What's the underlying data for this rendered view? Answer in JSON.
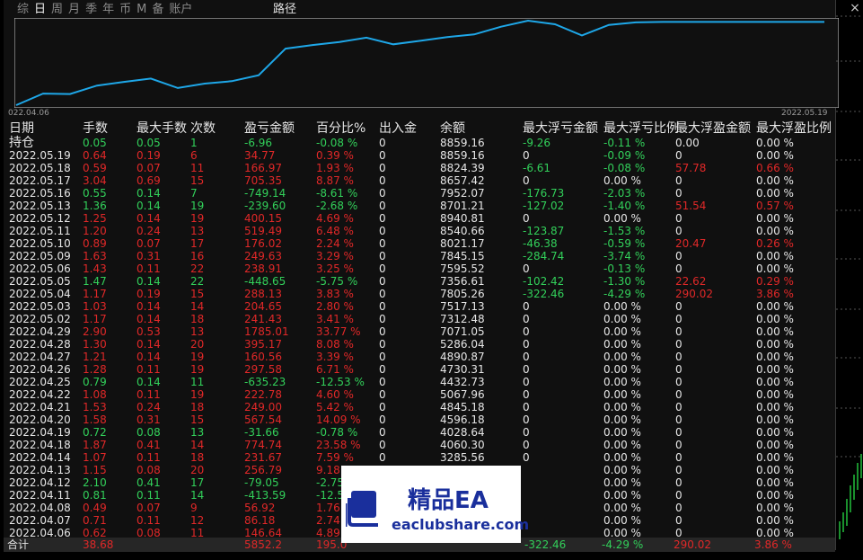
{
  "tabs": [
    "综",
    "日",
    "周",
    "月",
    "季",
    "年",
    "币",
    "M",
    "备",
    "账户"
  ],
  "active_tab": 1,
  "curve_label": "路径",
  "chart": {
    "start_label": "022.04.06",
    "end_label": "2022.05.19",
    "line_color": "#1ea7e8"
  },
  "chart_data": {
    "type": "line",
    "x": [
      "2022.04.06",
      "2022.04.07",
      "2022.04.08",
      "2022.04.11",
      "2022.04.12",
      "2022.04.13",
      "2022.04.14",
      "2022.04.18",
      "2022.04.19",
      "2022.04.20",
      "2022.04.21",
      "2022.04.22",
      "2022.04.25",
      "2022.04.26",
      "2022.04.27",
      "2022.04.28",
      "2022.04.29",
      "2022.05.02",
      "2022.05.03",
      "2022.05.04",
      "2022.05.05",
      "2022.05.06",
      "2022.05.09",
      "2022.05.10",
      "2022.05.11",
      "2022.05.12",
      "2022.05.13",
      "2022.05.16",
      "2022.05.17",
      "2022.05.18",
      "2022.05.19"
    ],
    "values": [
      3285.56,
      4060.3,
      4028.64,
      4596.18,
      4845.18,
      5067.96,
      4432.73,
      4730.31,
      4890.87,
      5286.04,
      7071.05,
      7312.48,
      7517.13,
      7805.26,
      7356.61,
      7595.52,
      7845.15,
      8021.17,
      8540.66,
      8940.81,
      8701.21,
      7952.07,
      8657.42,
      8824.39,
      8859.16,
      8859.16,
      8859.16,
      8859.16,
      8859.16,
      8859.16,
      8859.16
    ],
    "title": "",
    "xlabel": "",
    "ylabel": ""
  },
  "close_icon": "×",
  "headers": [
    "日期",
    "手数",
    "最大手数",
    "次数",
    "盈亏金额",
    "百分比%",
    "出入金",
    "余额",
    "最大浮亏金额",
    "最大浮亏比例",
    "最大浮盈金额",
    "最大浮盈比例"
  ],
  "rows": [
    {
      "date": "持仓",
      "lots": "0.05",
      "maxlots": "0.05",
      "count": "1",
      "pl": "-6.96",
      "pct": "-0.08 %",
      "io": "0",
      "bal": "8859.16",
      "mfl": "-9.26",
      "mflp": "-0.11 %",
      "mfp": "0.00",
      "mfpp": "0.00 %",
      "c": "g",
      "fl": "g",
      "fp": "w"
    },
    {
      "date": "2022.05.19",
      "lots": "0.64",
      "maxlots": "0.19",
      "count": "6",
      "pl": "34.77",
      "pct": "0.39 %",
      "io": "0",
      "bal": "8859.16",
      "mfl": "0",
      "mflp": "-0.09 %",
      "mfp": "0",
      "mfpp": "0.00 %",
      "c": "r",
      "fl": "w",
      "fp": "w"
    },
    {
      "date": "2022.05.18",
      "lots": "0.59",
      "maxlots": "0.07",
      "count": "11",
      "pl": "166.97",
      "pct": "1.93 %",
      "io": "0",
      "bal": "8824.39",
      "mfl": "-6.61",
      "mflp": "-0.08 %",
      "mfp": "57.78",
      "mfpp": "0.66 %",
      "c": "r",
      "fl": "g",
      "fp": "r"
    },
    {
      "date": "2022.05.17",
      "lots": "3.04",
      "maxlots": "0.69",
      "count": "15",
      "pl": "705.35",
      "pct": "8.87 %",
      "io": "0",
      "bal": "8657.42",
      "mfl": "0",
      "mflp": "0.00 %",
      "mfp": "0",
      "mfpp": "0.00 %",
      "c": "r",
      "fl": "w",
      "fp": "w"
    },
    {
      "date": "2022.05.16",
      "lots": "0.55",
      "maxlots": "0.14",
      "count": "7",
      "pl": "-749.14",
      "pct": "-8.61 %",
      "io": "0",
      "bal": "7952.07",
      "mfl": "-176.73",
      "mflp": "-2.03 %",
      "mfp": "0",
      "mfpp": "0.00 %",
      "c": "g",
      "fl": "g",
      "fp": "w"
    },
    {
      "date": "2022.05.13",
      "lots": "1.36",
      "maxlots": "0.14",
      "count": "19",
      "pl": "-239.60",
      "pct": "-2.68 %",
      "io": "0",
      "bal": "8701.21",
      "mfl": "-127.02",
      "mflp": "-1.40 %",
      "mfp": "51.54",
      "mfpp": "0.57 %",
      "c": "g",
      "fl": "g",
      "fp": "r"
    },
    {
      "date": "2022.05.12",
      "lots": "1.25",
      "maxlots": "0.14",
      "count": "19",
      "pl": "400.15",
      "pct": "4.69 %",
      "io": "0",
      "bal": "8940.81",
      "mfl": "0",
      "mflp": "0.00 %",
      "mfp": "0",
      "mfpp": "0.00 %",
      "c": "r",
      "fl": "w",
      "fp": "w"
    },
    {
      "date": "2022.05.11",
      "lots": "1.20",
      "maxlots": "0.24",
      "count": "13",
      "pl": "519.49",
      "pct": "6.48 %",
      "io": "0",
      "bal": "8540.66",
      "mfl": "-123.87",
      "mflp": "-1.53 %",
      "mfp": "0",
      "mfpp": "0.00 %",
      "c": "r",
      "fl": "g",
      "fp": "w"
    },
    {
      "date": "2022.05.10",
      "lots": "0.89",
      "maxlots": "0.07",
      "count": "17",
      "pl": "176.02",
      "pct": "2.24 %",
      "io": "0",
      "bal": "8021.17",
      "mfl": "-46.38",
      "mflp": "-0.59 %",
      "mfp": "20.47",
      "mfpp": "0.26 %",
      "c": "r",
      "fl": "g",
      "fp": "r"
    },
    {
      "date": "2022.05.09",
      "lots": "1.63",
      "maxlots": "0.31",
      "count": "16",
      "pl": "249.63",
      "pct": "3.29 %",
      "io": "0",
      "bal": "7845.15",
      "mfl": "-284.74",
      "mflp": "-3.74 %",
      "mfp": "0",
      "mfpp": "0.00 %",
      "c": "r",
      "fl": "g",
      "fp": "w"
    },
    {
      "date": "2022.05.06",
      "lots": "1.43",
      "maxlots": "0.11",
      "count": "22",
      "pl": "238.91",
      "pct": "3.25 %",
      "io": "0",
      "bal": "7595.52",
      "mfl": "0",
      "mflp": "-0.13 %",
      "mfp": "0",
      "mfpp": "0.00 %",
      "c": "r",
      "fl": "w",
      "fp": "w"
    },
    {
      "date": "2022.05.05",
      "lots": "1.47",
      "maxlots": "0.14",
      "count": "22",
      "pl": "-448.65",
      "pct": "-5.75 %",
      "io": "0",
      "bal": "7356.61",
      "mfl": "-102.42",
      "mflp": "-1.30 %",
      "mfp": "22.62",
      "mfpp": "0.29 %",
      "c": "g",
      "fl": "g",
      "fp": "r"
    },
    {
      "date": "2022.05.04",
      "lots": "1.17",
      "maxlots": "0.19",
      "count": "15",
      "pl": "288.13",
      "pct": "3.83 %",
      "io": "0",
      "bal": "7805.26",
      "mfl": "-322.46",
      "mflp": "-4.29 %",
      "mfp": "290.02",
      "mfpp": "3.86 %",
      "c": "r",
      "fl": "g",
      "fp": "r"
    },
    {
      "date": "2022.05.03",
      "lots": "1.03",
      "maxlots": "0.14",
      "count": "14",
      "pl": "204.65",
      "pct": "2.80 %",
      "io": "0",
      "bal": "7517.13",
      "mfl": "0",
      "mflp": "0.00 %",
      "mfp": "0",
      "mfpp": "0.00 %",
      "c": "r",
      "fl": "w",
      "fp": "w"
    },
    {
      "date": "2022.05.02",
      "lots": "1.17",
      "maxlots": "0.14",
      "count": "18",
      "pl": "241.43",
      "pct": "3.41 %",
      "io": "0",
      "bal": "7312.48",
      "mfl": "0",
      "mflp": "0.00 %",
      "mfp": "0",
      "mfpp": "0.00 %",
      "c": "r",
      "fl": "w",
      "fp": "w"
    },
    {
      "date": "2022.04.29",
      "lots": "2.90",
      "maxlots": "0.53",
      "count": "13",
      "pl": "1785.01",
      "pct": "33.77 %",
      "io": "0",
      "bal": "7071.05",
      "mfl": "0",
      "mflp": "0.00 %",
      "mfp": "0",
      "mfpp": "0.00 %",
      "c": "r",
      "fl": "w",
      "fp": "w"
    },
    {
      "date": "2022.04.28",
      "lots": "1.30",
      "maxlots": "0.14",
      "count": "20",
      "pl": "395.17",
      "pct": "8.08 %",
      "io": "0",
      "bal": "5286.04",
      "mfl": "0",
      "mflp": "0.00 %",
      "mfp": "0",
      "mfpp": "0.00 %",
      "c": "r",
      "fl": "w",
      "fp": "w"
    },
    {
      "date": "2022.04.27",
      "lots": "1.21",
      "maxlots": "0.14",
      "count": "19",
      "pl": "160.56",
      "pct": "3.39 %",
      "io": "0",
      "bal": "4890.87",
      "mfl": "0",
      "mflp": "0.00 %",
      "mfp": "0",
      "mfpp": "0.00 %",
      "c": "r",
      "fl": "w",
      "fp": "w"
    },
    {
      "date": "2022.04.26",
      "lots": "1.28",
      "maxlots": "0.11",
      "count": "19",
      "pl": "297.58",
      "pct": "6.71 %",
      "io": "0",
      "bal": "4730.31",
      "mfl": "0",
      "mflp": "0.00 %",
      "mfp": "0",
      "mfpp": "0.00 %",
      "c": "r",
      "fl": "w",
      "fp": "w"
    },
    {
      "date": "2022.04.25",
      "lots": "0.79",
      "maxlots": "0.14",
      "count": "11",
      "pl": "-635.23",
      "pct": "-12.53 %",
      "io": "0",
      "bal": "4432.73",
      "mfl": "0",
      "mflp": "0.00 %",
      "mfp": "0",
      "mfpp": "0.00 %",
      "c": "g",
      "fl": "w",
      "fp": "w"
    },
    {
      "date": "2022.04.22",
      "lots": "1.08",
      "maxlots": "0.11",
      "count": "19",
      "pl": "222.78",
      "pct": "4.60 %",
      "io": "0",
      "bal": "5067.96",
      "mfl": "0",
      "mflp": "0.00 %",
      "mfp": "0",
      "mfpp": "0.00 %",
      "c": "r",
      "fl": "w",
      "fp": "w"
    },
    {
      "date": "2022.04.21",
      "lots": "1.53",
      "maxlots": "0.24",
      "count": "18",
      "pl": "249.00",
      "pct": "5.42 %",
      "io": "0",
      "bal": "4845.18",
      "mfl": "0",
      "mflp": "0.00 %",
      "mfp": "0",
      "mfpp": "0.00 %",
      "c": "r",
      "fl": "w",
      "fp": "w"
    },
    {
      "date": "2022.04.20",
      "lots": "1.58",
      "maxlots": "0.31",
      "count": "15",
      "pl": "567.54",
      "pct": "14.09 %",
      "io": "0",
      "bal": "4596.18",
      "mfl": "0",
      "mflp": "0.00 %",
      "mfp": "0",
      "mfpp": "0.00 %",
      "c": "r",
      "fl": "w",
      "fp": "w"
    },
    {
      "date": "2022.04.19",
      "lots": "0.72",
      "maxlots": "0.08",
      "count": "13",
      "pl": "-31.66",
      "pct": "-0.78 %",
      "io": "0",
      "bal": "4028.64",
      "mfl": "0",
      "mflp": "0.00 %",
      "mfp": "0",
      "mfpp": "0.00 %",
      "c": "g",
      "fl": "w",
      "fp": "w"
    },
    {
      "date": "2022.04.18",
      "lots": "1.87",
      "maxlots": "0.41",
      "count": "14",
      "pl": "774.74",
      "pct": "23.58 %",
      "io": "0",
      "bal": "4060.30",
      "mfl": "0",
      "mflp": "0.00 %",
      "mfp": "0",
      "mfpp": "0.00 %",
      "c": "r",
      "fl": "w",
      "fp": "w"
    },
    {
      "date": "2022.04.14",
      "lots": "1.07",
      "maxlots": "0.11",
      "count": "18",
      "pl": "231.67",
      "pct": "7.59 %",
      "io": "0",
      "bal": "3285.56",
      "mfl": "0",
      "mflp": "0.00 %",
      "mfp": "0",
      "mfpp": "0.00 %",
      "c": "r",
      "fl": "w",
      "fp": "w"
    },
    {
      "date": "2022.04.13",
      "lots": "1.15",
      "maxlots": "0.08",
      "count": "20",
      "pl": "256.79",
      "pct": "9.18 %",
      "io": "",
      "bal": "",
      "mfl": "",
      "mflp": "0.00 %",
      "mfp": "0",
      "mfpp": "0.00 %",
      "c": "r",
      "fl": "w",
      "fp": "w"
    },
    {
      "date": "2022.04.12",
      "lots": "2.10",
      "maxlots": "0.41",
      "count": "17",
      "pl": "-79.05",
      "pct": "-2.75",
      "io": "",
      "bal": "",
      "mfl": "",
      "mflp": "0.00 %",
      "mfp": "0",
      "mfpp": "0.00 %",
      "c": "g",
      "fl": "w",
      "fp": "w"
    },
    {
      "date": "2022.04.11",
      "lots": "0.81",
      "maxlots": "0.11",
      "count": "14",
      "pl": "-413.59",
      "pct": "-12.57",
      "io": "",
      "bal": "",
      "mfl": "",
      "mflp": "0.00 %",
      "mfp": "0",
      "mfpp": "0.00 %",
      "c": "g",
      "fl": "w",
      "fp": "w"
    },
    {
      "date": "2022.04.08",
      "lots": "0.49",
      "maxlots": "0.07",
      "count": "9",
      "pl": "56.92",
      "pct": "1.76",
      "io": "",
      "bal": "",
      "mfl": "",
      "mflp": "0.00 %",
      "mfp": "0",
      "mfpp": "0.00 %",
      "c": "r",
      "fl": "w",
      "fp": "w"
    },
    {
      "date": "2022.04.07",
      "lots": "0.71",
      "maxlots": "0.11",
      "count": "12",
      "pl": "86.18",
      "pct": "2.74",
      "io": "",
      "bal": "",
      "mfl": "",
      "mflp": "0.00 %",
      "mfp": "0",
      "mfpp": "0.00 %",
      "c": "r",
      "fl": "w",
      "fp": "w"
    },
    {
      "date": "2022.04.06",
      "lots": "0.62",
      "maxlots": "0.08",
      "count": "11",
      "pl": "146.64",
      "pct": "4.89",
      "io": "",
      "bal": "",
      "mfl": "",
      "mflp": "0.00 %",
      "mfp": "0",
      "mfpp": "0.00 %",
      "c": "r",
      "fl": "w",
      "fp": "w"
    }
  ],
  "footer": {
    "label": "合计",
    "lots": "38.68",
    "pl": "5852.2",
    "pct": "195.0",
    "mfl": "-322.46",
    "mflp": "-4.29 %",
    "mfp": "290.02",
    "mfpp": "3.86 %"
  },
  "watermark": {
    "title": "精品EA",
    "url": "eaclubshare.com",
    "logo_icon": "stacked-books-icon",
    "color": "#1a2f9c"
  }
}
